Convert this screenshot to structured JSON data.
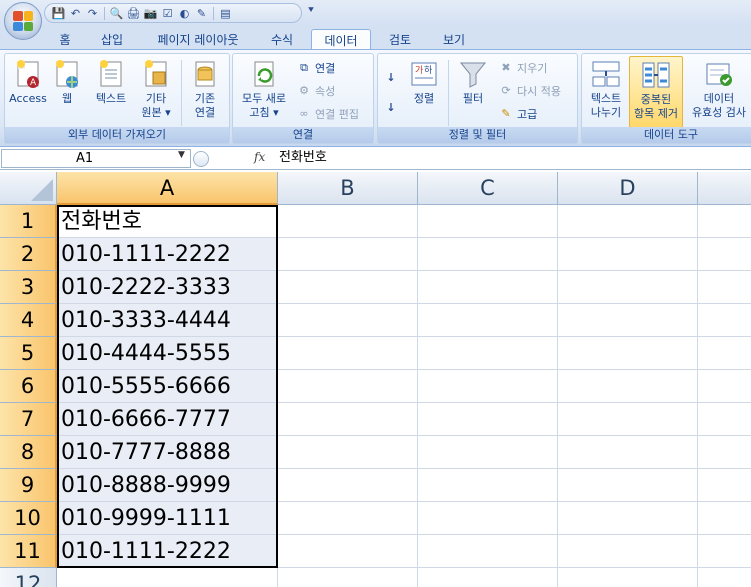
{
  "quick_access": {
    "buttons": [
      {
        "name": "save-icon",
        "glyph": "💾"
      },
      {
        "name": "undo-icon",
        "glyph": "↶"
      },
      {
        "name": "redo-icon",
        "glyph": "↷"
      },
      {
        "name": "print-preview-icon",
        "glyph": "🔍"
      },
      {
        "name": "print-icon",
        "glyph": "🖨"
      },
      {
        "name": "camera-icon",
        "glyph": "📷"
      },
      {
        "name": "checkbox-icon",
        "glyph": "☑"
      },
      {
        "name": "option-icon",
        "glyph": "◐"
      },
      {
        "name": "draw-icon",
        "glyph": "✎"
      },
      {
        "name": "form-icon",
        "glyph": "▤"
      }
    ],
    "more_glyph": "⯆"
  },
  "tabs": [
    "홈",
    "삽입",
    "페이지 레이아웃",
    "수식",
    "데이터",
    "검토",
    "보기"
  ],
  "active_tab": "데이터",
  "ribbon": {
    "external_data": {
      "label": "외부 데이터 가져오기",
      "access": "Access",
      "web": "웹",
      "text": "텍스트",
      "other": "기타\n원본 ▾",
      "existing": "기존\n연결"
    },
    "connections": {
      "label": "연결",
      "refresh_all": "모두 새로\n고침 ▾",
      "connections": "연결",
      "properties": "속성",
      "edit_links": "연결 편집"
    },
    "sort_filter": {
      "label": "정렬 및 필터",
      "sort": "정렬",
      "filter": "필터",
      "clear": "지우기",
      "reapply": "다시 적용",
      "advanced": "고급",
      "az_icon": "가\n하"
    },
    "data_tools": {
      "label": "데이터 도구",
      "text_to_columns": "텍스트\n나누기",
      "remove_duplicates": "중복된\n항목 제거",
      "data_validation": "데이터\n유효성 검사"
    }
  },
  "formula_bar": {
    "name_box": "A1",
    "fx": "fx",
    "formula": "전화번호"
  },
  "sheet": {
    "columns": [
      "A",
      "B",
      "C",
      "D"
    ],
    "rows": [
      "1",
      "2",
      "3",
      "4",
      "5",
      "6",
      "7",
      "8",
      "9",
      "10",
      "11",
      "12"
    ],
    "column_a": [
      "전화번호",
      "010-1111-2222",
      "010-2222-3333",
      "010-3333-4444",
      "010-4444-5555",
      "010-5555-6666",
      "010-6666-7777",
      "010-7777-8888",
      "010-8888-9999",
      "010-9999-1111",
      "010-1111-2222"
    ]
  }
}
